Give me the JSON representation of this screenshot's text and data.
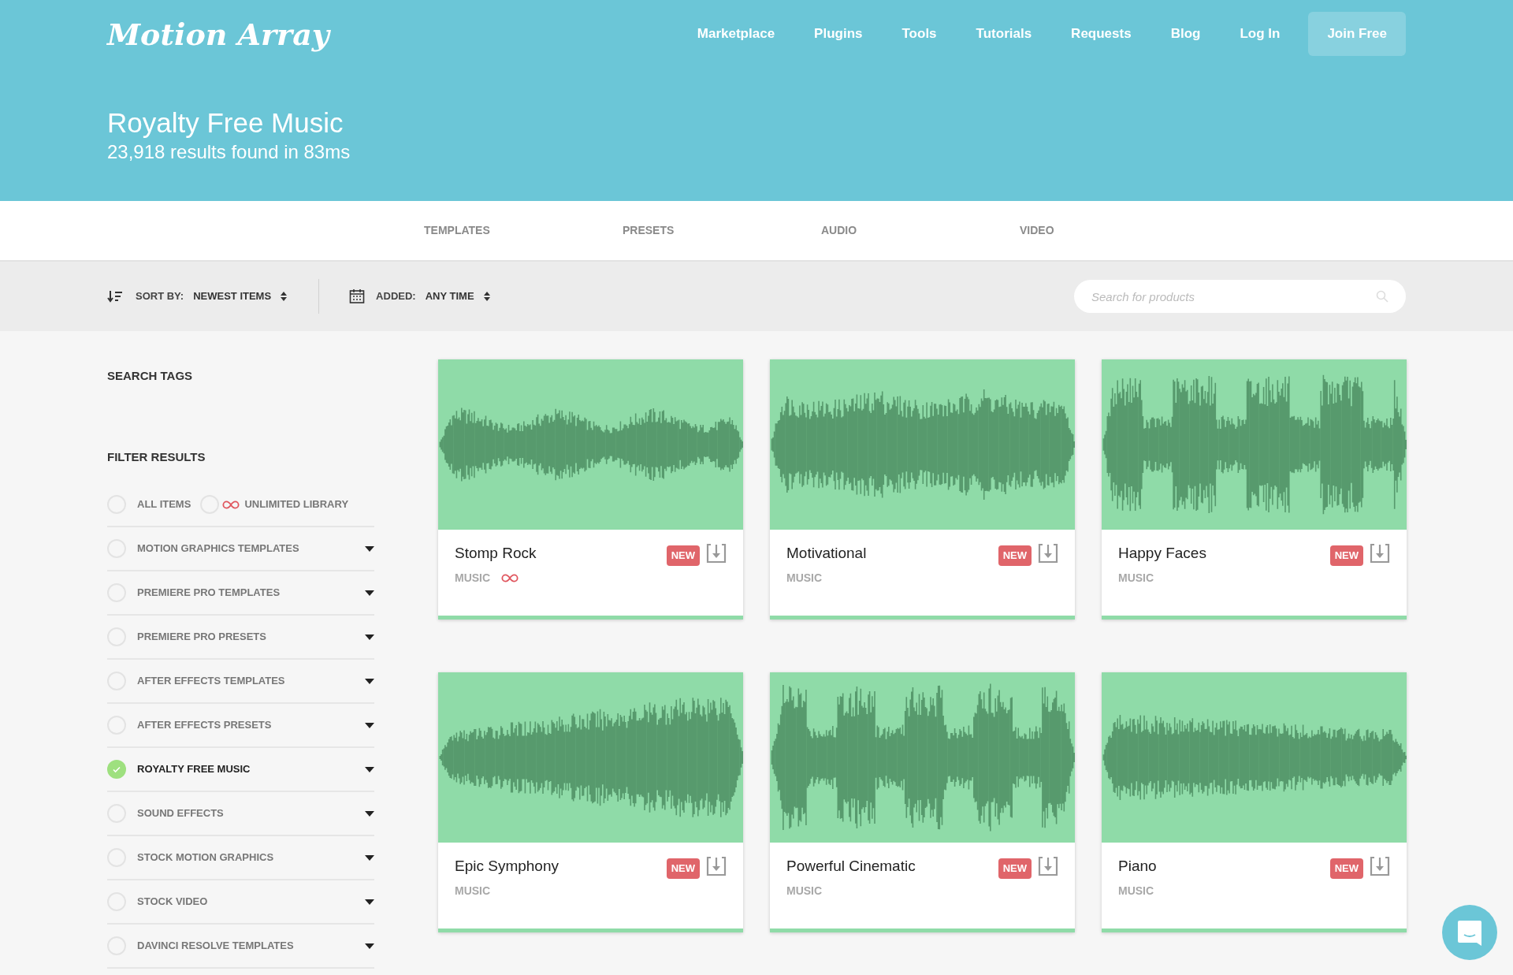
{
  "header": {
    "logo": "Motion Array",
    "nav": [
      {
        "label": "Marketplace",
        "kind": "link"
      },
      {
        "label": "Plugins",
        "kind": "link"
      },
      {
        "label": "Tools",
        "kind": "link"
      },
      {
        "label": "Tutorials",
        "kind": "link"
      },
      {
        "label": "Requests",
        "kind": "link"
      },
      {
        "label": "Blog",
        "kind": "link"
      },
      {
        "label": "Log In",
        "kind": "link"
      },
      {
        "label": "Join Free",
        "kind": "button"
      }
    ],
    "title": "Royalty Free Music",
    "subtitle": "23,918 results found in 83ms"
  },
  "tabs": [
    {
      "label": "TEMPLATES",
      "selected": false
    },
    {
      "label": "PRESETS",
      "selected": false
    },
    {
      "label": "AUDIO",
      "selected": false
    },
    {
      "label": "VIDEO",
      "selected": false
    }
  ],
  "toolbar": {
    "sort_label": "SORT BY:",
    "sort_value": "NEWEST ITEMS",
    "added_label": "ADDED:",
    "added_value": "ANY TIME",
    "search": {
      "placeholder": "Search for products"
    }
  },
  "sidebar": {
    "search_tags_heading": "SEARCH TAGS",
    "filter_heading": "FILTER RESULTS",
    "top_filters": [
      {
        "label": "ALL ITEMS",
        "selected": false,
        "unlimited": false
      },
      {
        "label": "UNLIMITED LIBRARY",
        "selected": false,
        "unlimited": true
      }
    ],
    "filters": [
      {
        "label": "MOTION GRAPHICS TEMPLATES",
        "selected": false
      },
      {
        "label": "PREMIERE PRO TEMPLATES",
        "selected": false
      },
      {
        "label": "PREMIERE PRO PRESETS",
        "selected": false
      },
      {
        "label": "AFTER EFFECTS TEMPLATES",
        "selected": false
      },
      {
        "label": "AFTER EFFECTS PRESETS",
        "selected": false
      },
      {
        "label": "ROYALTY FREE MUSIC",
        "selected": true
      },
      {
        "label": "SOUND EFFECTS",
        "selected": false
      },
      {
        "label": "STOCK MOTION GRAPHICS",
        "selected": false
      },
      {
        "label": "STOCK VIDEO",
        "selected": false
      },
      {
        "label": "DAVINCI RESOLVE TEMPLATES",
        "selected": false
      }
    ]
  },
  "products": [
    {
      "title": "Stomp Rock",
      "category": "MUSIC",
      "badge": "NEW",
      "unlimited": true
    },
    {
      "title": "Motivational",
      "category": "MUSIC",
      "badge": "NEW",
      "unlimited": false
    },
    {
      "title": "Happy Faces",
      "category": "MUSIC",
      "badge": "NEW",
      "unlimited": false
    },
    {
      "title": "Epic Symphony",
      "category": "MUSIC",
      "badge": "NEW",
      "unlimited": false
    },
    {
      "title": "Powerful Cinematic",
      "category": "MUSIC",
      "badge": "NEW",
      "unlimited": false
    },
    {
      "title": "Piano",
      "category": "MUSIC",
      "badge": "NEW",
      "unlimited": false
    }
  ]
}
